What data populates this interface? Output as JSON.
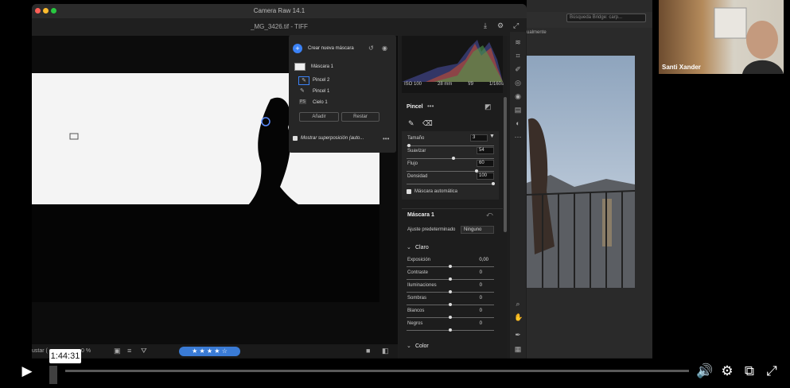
{
  "window": {
    "title": "Camera Raw 14.1",
    "file_name": "_MG_3426.tif - TIFF"
  },
  "bridge": {
    "search_placeholder": "Búsqueda Bridge: carp...",
    "view_label": "ualmente"
  },
  "webcam": {
    "participant_name": "Santi Xander"
  },
  "mask_panel": {
    "create_label": "Crear nueva máscara",
    "items": [
      {
        "label": "Máscara 1"
      },
      {
        "label": "Pincel 2"
      },
      {
        "label": "Pincel 1"
      },
      {
        "label": "Cielo 1"
      }
    ],
    "add_button": "Añadir",
    "subtract_button": "Restar",
    "overlay_label": "Mostrar superposición (auto..."
  },
  "histogram": {
    "iso": "ISO 100",
    "focal": "28 mm",
    "aperture": "f/9",
    "shutter": "1/160s"
  },
  "brush": {
    "title": "Pincel",
    "sliders": [
      {
        "label": "Tamaño",
        "value": "3"
      },
      {
        "label": "Suavizar",
        "value": "54"
      },
      {
        "label": "Flujo",
        "value": "60"
      },
      {
        "label": "Densidad",
        "value": "100"
      }
    ],
    "auto_mask_label": "Máscara automática"
  },
  "mask_settings": {
    "title": "Máscara 1",
    "preset_label": "Ajuste predeterminado",
    "preset_value": "Ninguno",
    "section_title": "Claro",
    "sliders": [
      {
        "label": "Exposición",
        "value": "0,00"
      },
      {
        "label": "Contraste",
        "value": "0"
      },
      {
        "label": "Iluminaciones",
        "value": "0"
      },
      {
        "label": "Sombras",
        "value": "0"
      },
      {
        "label": "Blancos",
        "value": "0"
      },
      {
        "label": "Negros",
        "value": "0"
      }
    ],
    "color_section": "Color"
  },
  "bottom_toolbar": {
    "zoom_left": "ustar (",
    "zoom_value": "0 %",
    "rating": "★ ★ ★ ★ ☆"
  },
  "player": {
    "timecode": "1:44:31"
  }
}
